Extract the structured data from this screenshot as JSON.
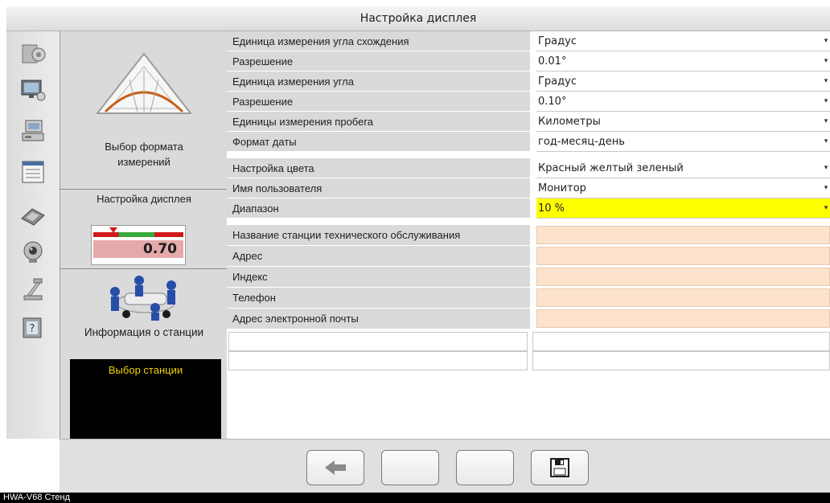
{
  "window": {
    "title": "Настройка дисплея"
  },
  "sidebar": {
    "icons": [
      "settings-icon",
      "monitor-icon",
      "computer-icon",
      "list-icon",
      "tools-icon",
      "webcam-icon",
      "lift-icon",
      "help-icon"
    ]
  },
  "left_panel": {
    "measurement_format_line1": "Выбор формата",
    "measurement_format_line2": "измерений",
    "display_settings": "Настройка  дисплея",
    "gauge_value": "0.70",
    "station_info": "Информация о станции",
    "station_select": "Выбор станции"
  },
  "settings": [
    {
      "label": "Единица измерения угла схождения",
      "value": "Градус"
    },
    {
      "label": "Разрешение",
      "value": "0.01°"
    },
    {
      "label": "Единица измерения угла",
      "value": "Градус"
    },
    {
      "label": "Разрешение",
      "value": "0.10°"
    },
    {
      "label": "Единицы измерения пробега",
      "value": "Километры"
    },
    {
      "label": "Формат даты",
      "value": "год-месяц-день"
    },
    {
      "label": "Настройка цвета",
      "value": "Красный желтый зеленый"
    },
    {
      "label": "Имя пользователя",
      "value": "Монитор"
    },
    {
      "label": "Диапазон",
      "value": "10 %"
    }
  ],
  "station_fields": [
    {
      "label": "Название станции технического обслуживания",
      "value": ""
    },
    {
      "label": "Адрес",
      "value": ""
    },
    {
      "label": "Индекс",
      "value": ""
    },
    {
      "label": "Телефон",
      "value": ""
    },
    {
      "label": "Адрес электронной почты",
      "value": ""
    }
  ],
  "bottom_buttons": [
    "back-button",
    "blank-button-1",
    "blank-button-2",
    "save-button"
  ],
  "status_bar": {
    "text": "HWA-V68  Стенд"
  },
  "colors": {
    "highlight": "#ffff00",
    "input_bg": "#fde3cc",
    "label_bg": "#d9d9d9"
  }
}
